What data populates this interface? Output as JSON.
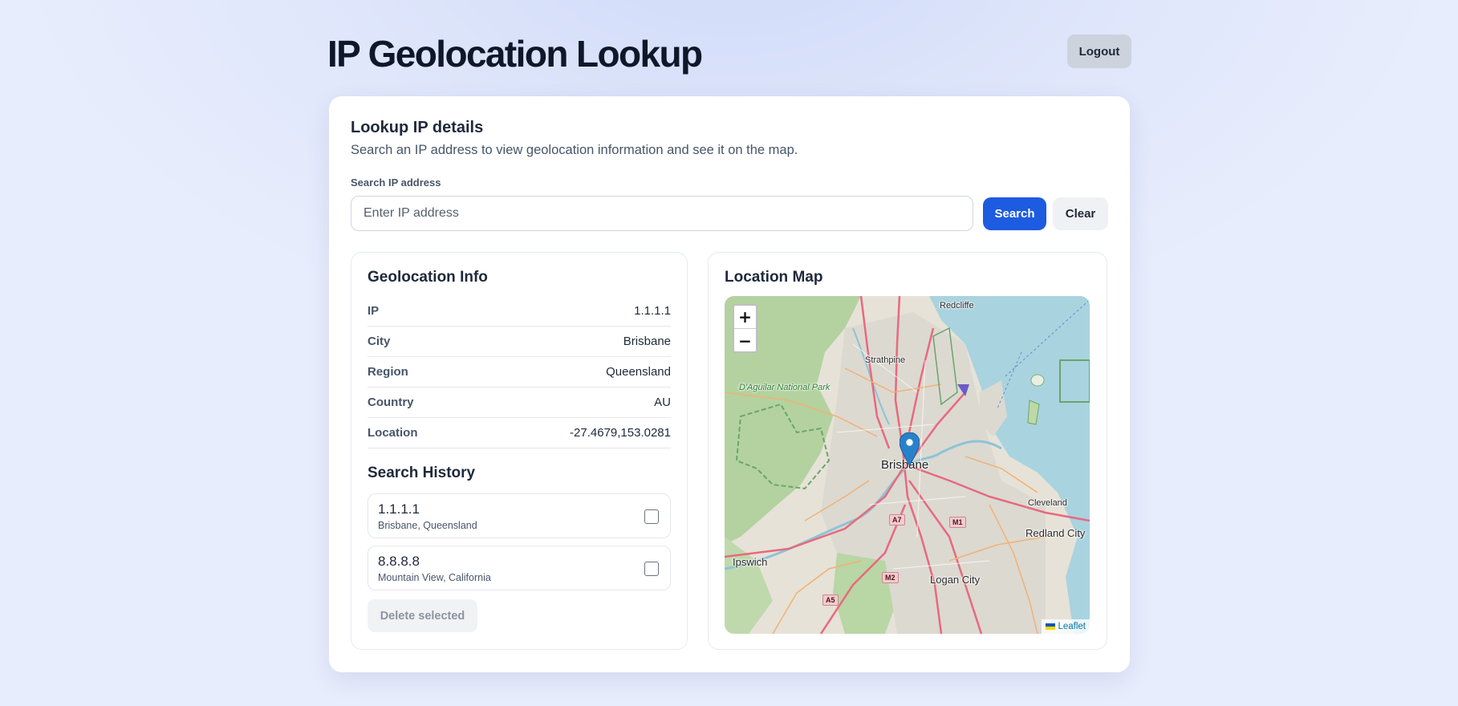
{
  "header": {
    "title": "IP Geolocation Lookup",
    "logout_label": "Logout"
  },
  "lookup": {
    "title": "Lookup IP details",
    "subtitle": "Search an IP address to view geolocation information and see it on the map.",
    "search_label": "Search IP address",
    "search_placeholder": "Enter IP address",
    "search_value": "",
    "search_button": "Search",
    "clear_button": "Clear"
  },
  "geo": {
    "title": "Geolocation Info",
    "rows": [
      {
        "key": "IP",
        "value": "1.1.1.1"
      },
      {
        "key": "City",
        "value": "Brisbane"
      },
      {
        "key": "Region",
        "value": "Queensland"
      },
      {
        "key": "Country",
        "value": "AU"
      },
      {
        "key": "Location",
        "value": "-27.4679,153.0281"
      }
    ]
  },
  "history": {
    "title": "Search History",
    "items": [
      {
        "ip": "1.1.1.1",
        "location": "Brisbane, Queensland",
        "checked": false
      },
      {
        "ip": "8.8.8.8",
        "location": "Mountain View, California",
        "checked": false
      }
    ],
    "delete_label": "Delete selected"
  },
  "map": {
    "title": "Location Map",
    "zoom_in": "+",
    "zoom_out": "−",
    "attribution": "Leaflet",
    "labels": {
      "redcliffe": "Redcliffe",
      "strathpine": "Strathpine",
      "park": "D'Aguilar National Park",
      "brisbane": "Brisbane",
      "cleveland": "Cleveland",
      "redland": "Redland City",
      "ipswich": "Ipswich",
      "logan": "Logan City"
    },
    "shields": {
      "a7": "A7",
      "m1": "M1",
      "m2": "M2",
      "a5": "A5"
    },
    "marker_icon": "map-pin-icon",
    "colors": {
      "water": "#a9d3df",
      "park": "#b3d2a0",
      "urban": "#dcd9d1",
      "roads": "#e8697e"
    }
  },
  "colors": {
    "primary": "#1d5be0",
    "title": "#0f172a"
  }
}
